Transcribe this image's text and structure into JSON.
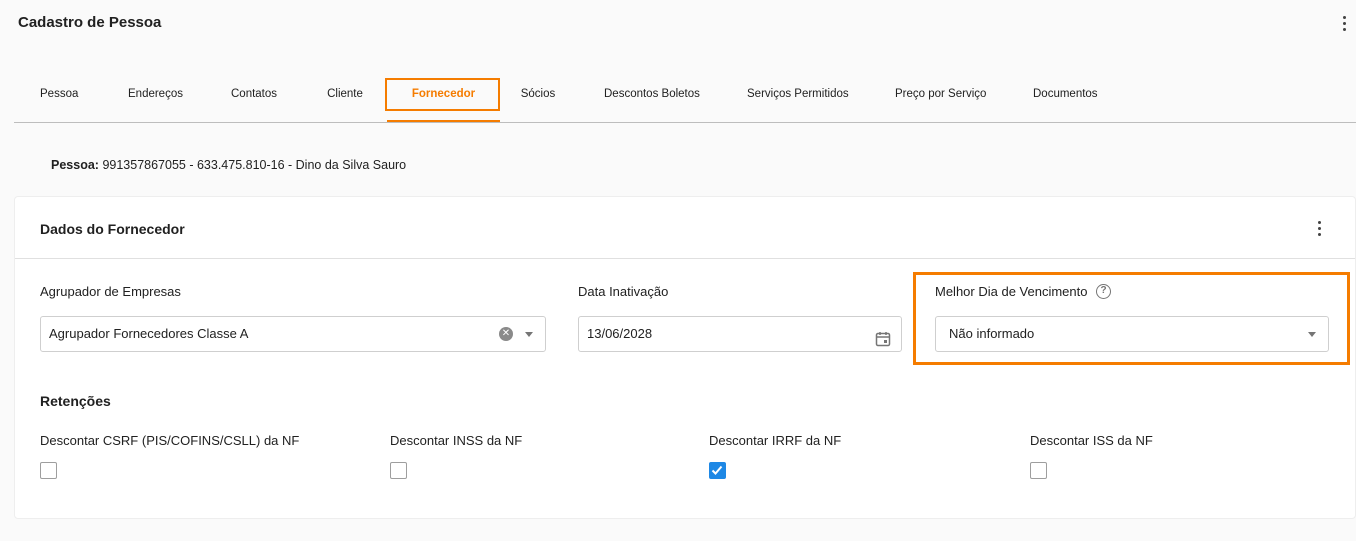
{
  "header": {
    "title": "Cadastro de Pessoa"
  },
  "tabs": [
    {
      "label": "Pessoa"
    },
    {
      "label": "Endereços"
    },
    {
      "label": "Contatos"
    },
    {
      "label": "Cliente"
    },
    {
      "label": "Fornecedor",
      "active": true
    },
    {
      "label": "Sócios"
    },
    {
      "label": "Descontos Boletos"
    },
    {
      "label": "Serviços Permitidos"
    },
    {
      "label": "Preço por Serviço"
    },
    {
      "label": "Documentos"
    }
  ],
  "pessoa": {
    "label": "Pessoa:",
    "value": "991357867055 - 633.475.810-16 - Dino da Silva Sauro"
  },
  "card": {
    "title": "Dados do Fornecedor",
    "fields": {
      "agrupador": {
        "label": "Agrupador de Empresas",
        "value": "Agrupador Fornecedores Classe A"
      },
      "data_inativacao": {
        "label": "Data Inativação",
        "value": "13/06/2028"
      },
      "melhor_dia": {
        "label": "Melhor Dia de Vencimento",
        "value": "Não informado"
      }
    },
    "retencoes": {
      "title": "Retenções",
      "items": [
        {
          "label": "Descontar CSRF (PIS/COFINS/CSLL) da NF",
          "checked": false
        },
        {
          "label": "Descontar INSS da NF",
          "checked": false
        },
        {
          "label": "Descontar IRRF da NF",
          "checked": true
        },
        {
          "label": "Descontar ISS da NF",
          "checked": false
        }
      ]
    }
  },
  "colors": {
    "accent": "#f57c00",
    "checkbox_checked": "#1e88e5"
  }
}
